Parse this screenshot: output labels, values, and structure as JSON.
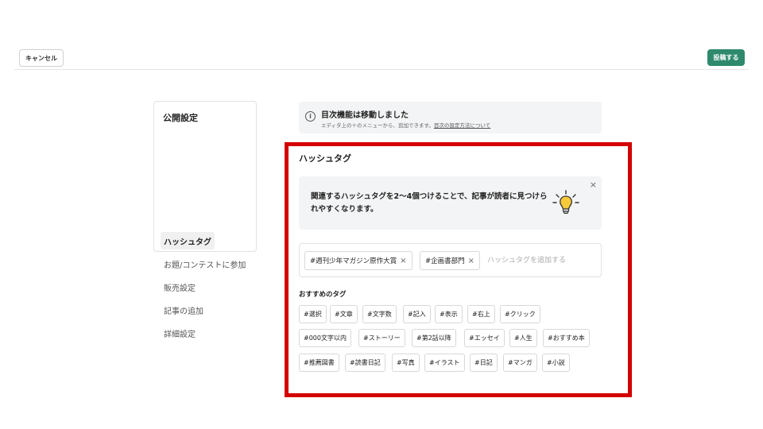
{
  "header": {
    "cancel_label": "キャンセル",
    "post_label": "投稿する",
    "post_color": "#2f8a6d"
  },
  "sidebar": {
    "title": "公開設定",
    "items": [
      {
        "label": "ハッシュタグ",
        "active": true
      },
      {
        "label": "お題/コンテストに参加",
        "active": false
      },
      {
        "label": "販売設定",
        "active": false
      },
      {
        "label": "記事の追加",
        "active": false
      },
      {
        "label": "詳細設定",
        "active": false
      }
    ]
  },
  "notice": {
    "icon": "info-icon",
    "title": "目次機能は移動しました",
    "subtitle": "エディタ上の＋のメニューから、追加できます。",
    "link": "目次の設定方法について"
  },
  "hashtag_section": {
    "title": "ハッシュタグ",
    "highlight_color": "#d40000",
    "tip": {
      "text": "関連するハッシュタグを2〜4個つけることで、記事が読者に見つけられやすくなります。",
      "close": "×",
      "icon": "lightbulb-icon"
    },
    "input": {
      "chips": [
        "#週刊少年マガジン原作大賞",
        "#企画書部門"
      ],
      "chip_remove": "×",
      "value": "",
      "placeholder": "ハッシュタグを追加する"
    },
    "recommended_title": "おすすめのタグ",
    "recommended_rows": [
      [
        "#選択",
        "#文章",
        "#文字数",
        "#記入",
        "#表示",
        "#右上",
        "#クリック"
      ],
      [
        "#000文字以内",
        "#ストーリー",
        "#第2話以降",
        "#エッセイ",
        "#人生",
        "#おすすめ本"
      ],
      [
        "#推薦図書",
        "#読書日記",
        "#写真",
        "#イラスト",
        "#日記",
        "#マンガ",
        "#小説"
      ]
    ]
  }
}
